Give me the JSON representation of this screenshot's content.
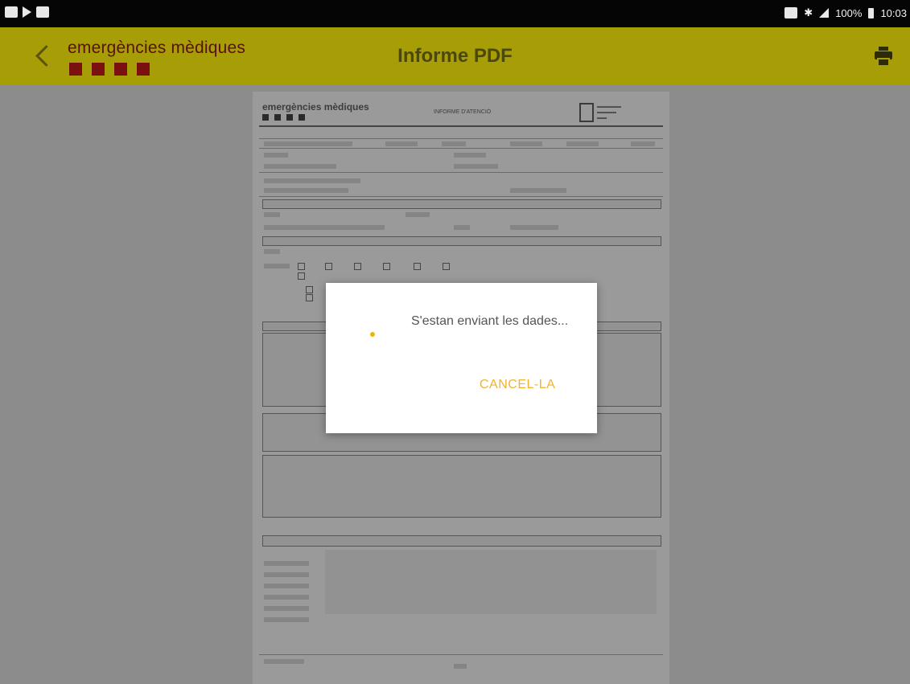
{
  "status_bar": {
    "battery_percent": "100%",
    "time": "10:03",
    "left_icons": [
      "image-icon",
      "play-icon",
      "notification-icon"
    ],
    "right_icons": [
      "cast-icon",
      "bluetooth-icon",
      "wifi-icon",
      "signal-icon",
      "battery-icon"
    ]
  },
  "app_bar": {
    "back_icon": "chevron-left-icon",
    "brand_name": "emergències mèdiques",
    "title": "Informe PDF",
    "print_icon": "print-icon",
    "colors": {
      "bar": "#a79d06",
      "brand": "#7a1010"
    }
  },
  "pdf": {
    "brand": "emergències mèdiques",
    "report_title": "INFORME D'ATENCIÓ"
  },
  "dialog": {
    "message": "S'estan enviant les dades...",
    "cancel_label": "CANCEL-LA",
    "accent_color": "#f1b233"
  }
}
